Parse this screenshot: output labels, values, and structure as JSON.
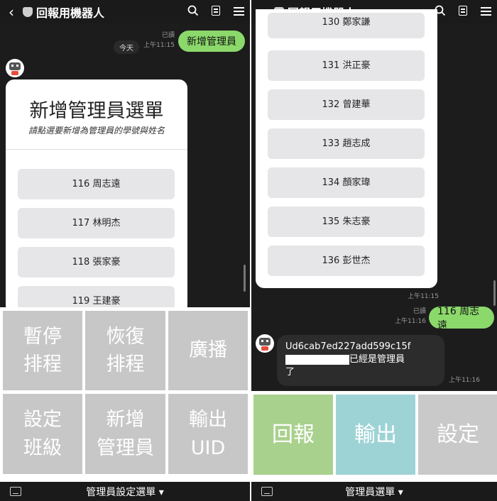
{
  "colors": {
    "line_green": "#8bd86b",
    "report_tile": "#a9d18e",
    "export_tile": "#9ed3d6",
    "settings_tile": "#c9c9c9",
    "dark_bg": "#1c1c1c"
  },
  "left": {
    "header": {
      "back_icon": "chevron-left-icon",
      "title": "回報用機器人",
      "search_icon": "search-icon",
      "notes_icon": "document-icon",
      "menu_icon": "hamburger-menu-icon"
    },
    "date_chip": "今天",
    "sent": {
      "text": "新增管理員",
      "read": "已讀",
      "time": "上午11:15"
    },
    "card": {
      "title": "新增管理員選單",
      "subtitle": "請點選要新增為管理員的學號與姓名",
      "options": [
        "116 周志遠",
        "117 林明杰",
        "118 張家豪",
        "119 王建豪"
      ]
    },
    "rich_menu": {
      "tiles": [
        {
          "line1": "暫停",
          "line2": "排程"
        },
        {
          "line1": "恢復",
          "line2": "排程"
        },
        {
          "line1": "廣播",
          "line2": ""
        },
        {
          "line1": "設定",
          "line2": "班級"
        },
        {
          "line1": "新增",
          "line2": "管理員"
        },
        {
          "line1": "輸出",
          "line2": "UID"
        }
      ]
    },
    "bottom": {
      "keyboard_icon": "keyboard-icon",
      "label": "管理員設定選單 ▾"
    }
  },
  "right": {
    "header": {
      "title": "回報用機器人"
    },
    "card": {
      "partial_option": "130 鄭家謙",
      "options": [
        "131 洪正豪",
        "132 曾建華",
        "133 趙志成",
        "134 顏家瑋",
        "135 朱志豪",
        "136 彭世杰"
      ],
      "time": "上午11:15"
    },
    "sent": {
      "text": "116 周志遠",
      "read": "已讀",
      "time": "上午11:16"
    },
    "reply": {
      "line1": "Ud6cab7ed227add599c15f",
      "line2_suffix": "已經是管理員",
      "line3": "了",
      "time": "上午11:16"
    },
    "rich_menu": {
      "tiles": [
        {
          "label": "回報"
        },
        {
          "label": "輸出"
        },
        {
          "label": "設定"
        }
      ]
    },
    "bottom": {
      "label": "管理員選單 ▾"
    }
  }
}
